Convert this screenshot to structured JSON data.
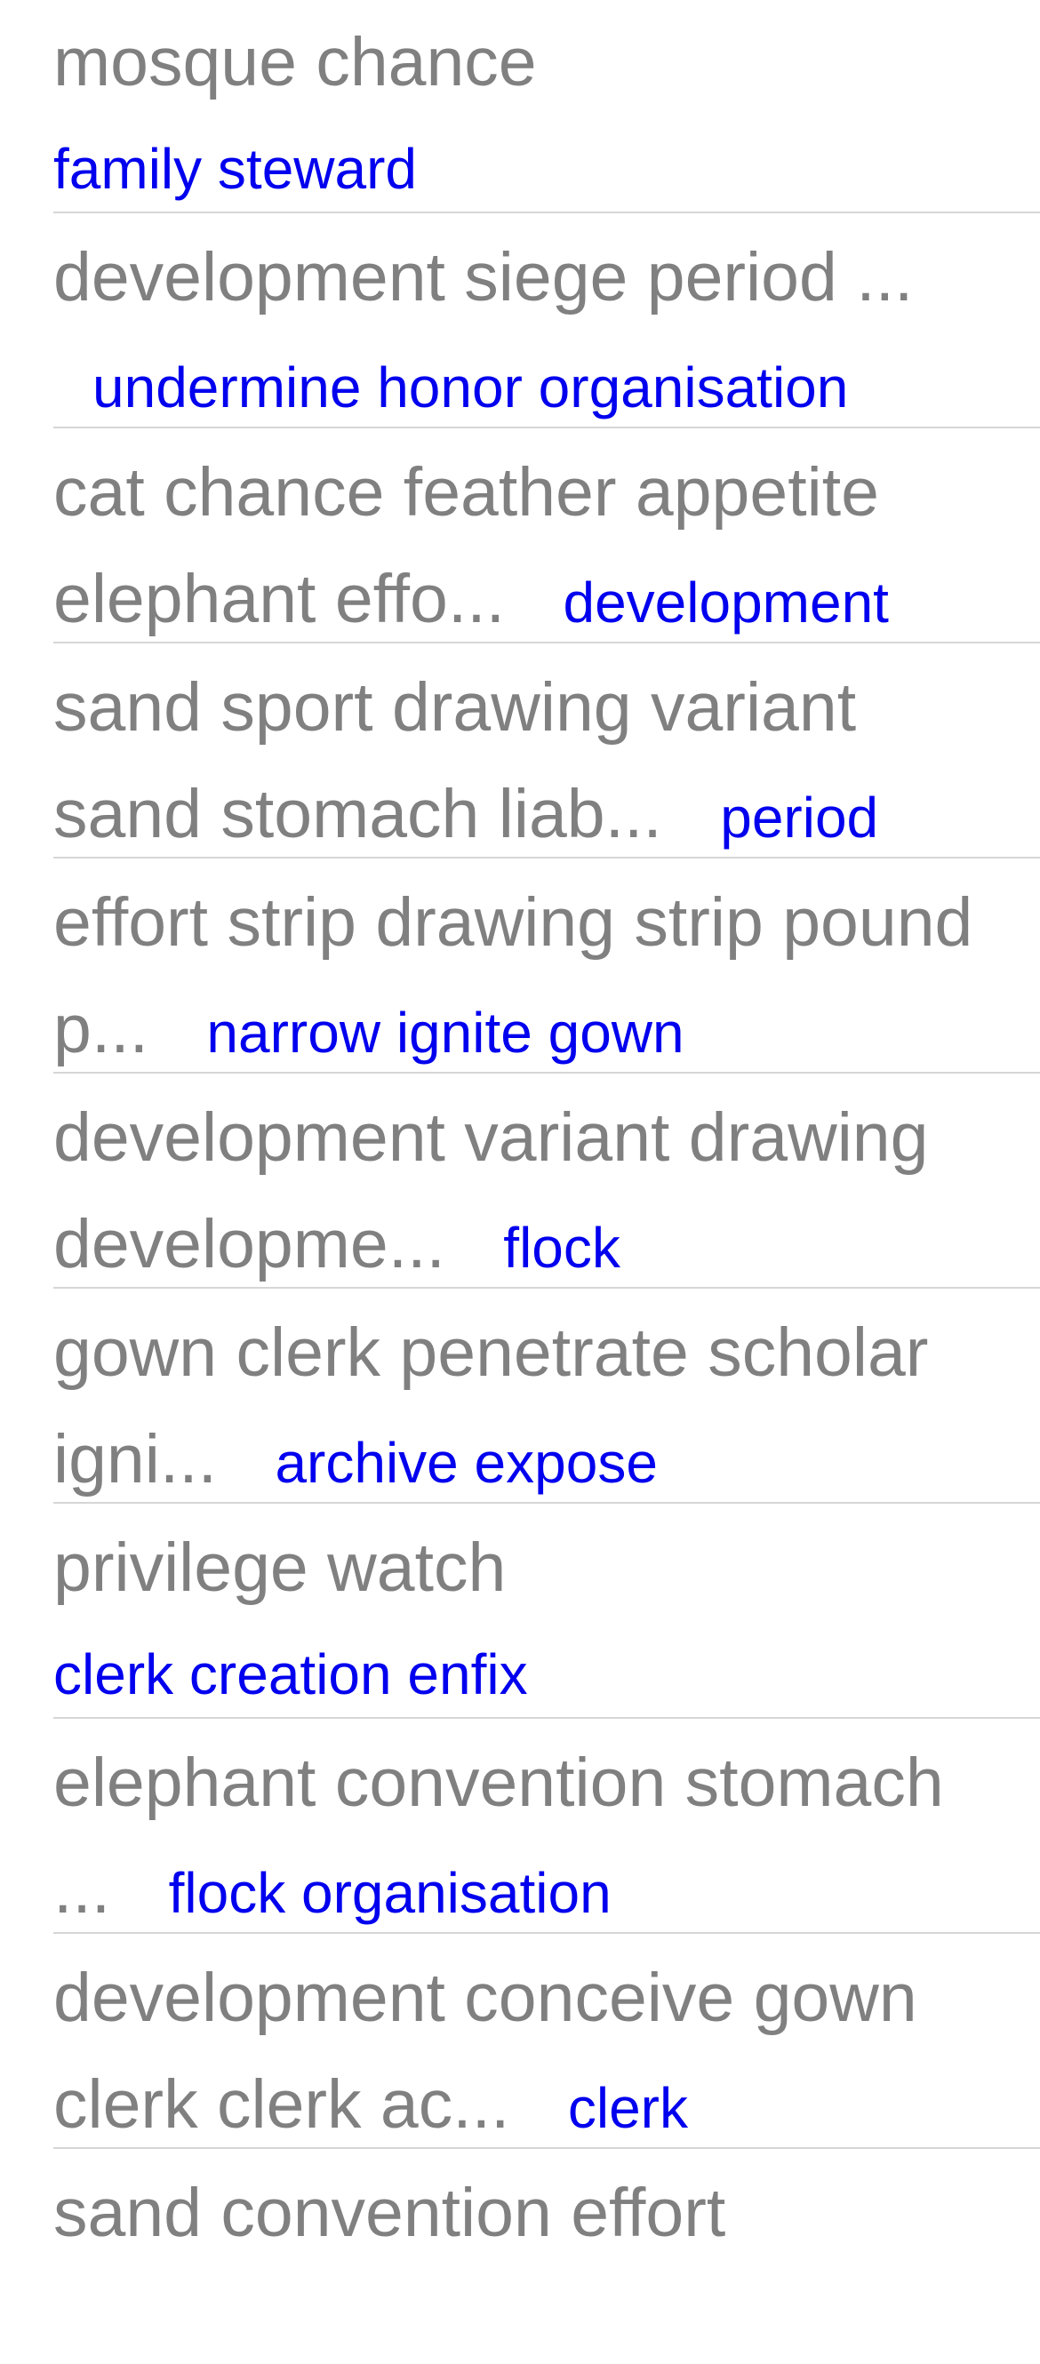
{
  "items": [
    {
      "title": "mosque chance",
      "link": "family steward",
      "link_newline": true
    },
    {
      "title": "development siege period ...",
      "link": "undermine honor organisation",
      "link_newline": false
    },
    {
      "title": "cat chance feather appetite elephant effo...",
      "link": "development",
      "link_newline": false
    },
    {
      "title": "sand sport drawing variant sand stomach liab...",
      "link": "period",
      "link_newline": false
    },
    {
      "title": "effort strip drawing strip pound p...",
      "link": "narrow ignite gown",
      "link_newline": false
    },
    {
      "title": "development variant drawing developme...",
      "link": "flock",
      "link_newline": false
    },
    {
      "title": "gown clerk penetrate scholar igni...",
      "link": "archive expose",
      "link_newline": false
    },
    {
      "title": "privilege watch",
      "link": "clerk creation enfix",
      "link_newline": true
    },
    {
      "title": "elephant convention stomach ...",
      "link": "flock organisation",
      "link_newline": false
    },
    {
      "title": "development conceive gown clerk clerk ac...",
      "link": "clerk",
      "link_newline": false
    },
    {
      "title": "sand convention effort",
      "link": "",
      "link_newline": false
    }
  ],
  "colors": {
    "title_text": "#808080",
    "link_text": "#0000ee",
    "separator": "#d6d6d6",
    "background": "#ffffff"
  }
}
